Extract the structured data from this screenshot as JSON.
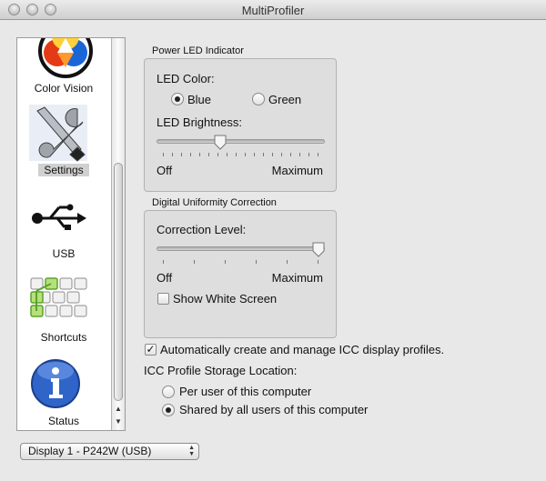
{
  "window": {
    "title": "MultiProfiler"
  },
  "sidebar": {
    "items": [
      {
        "label": "Color Vision",
        "icon": "color-wheel-icon"
      },
      {
        "label": "Settings",
        "icon": "wrench-screwdriver-icon",
        "selected": true
      },
      {
        "label": "USB",
        "icon": "usb-icon"
      },
      {
        "label": "Shortcuts",
        "icon": "keyboard-icon"
      },
      {
        "label": "Status",
        "icon": "info-icon"
      }
    ]
  },
  "power_led": {
    "group_title": "Power LED Indicator",
    "color_label": "LED Color:",
    "options": [
      "Blue",
      "Green"
    ],
    "selected": "Blue",
    "brightness_label": "LED Brightness:",
    "brightness_value": 0.37,
    "min_label": "Off",
    "max_label": "Maximum"
  },
  "uniformity": {
    "group_title": "Digital Uniformity Correction",
    "level_label": "Correction Level:",
    "level_value": 1.0,
    "min_label": "Off",
    "max_label": "Maximum",
    "white_screen_label": "Show White Screen",
    "white_screen_checked": false
  },
  "icc": {
    "auto_label": "Automatically create and manage ICC display profiles.",
    "auto_checked": true,
    "location_label": "ICC Profile Storage Location:",
    "options": [
      "Per user of this computer",
      "Shared by all users of this computer"
    ],
    "selected": "Shared by all users of this computer"
  },
  "display_select": {
    "value": "Display 1 - P242W (USB)"
  }
}
